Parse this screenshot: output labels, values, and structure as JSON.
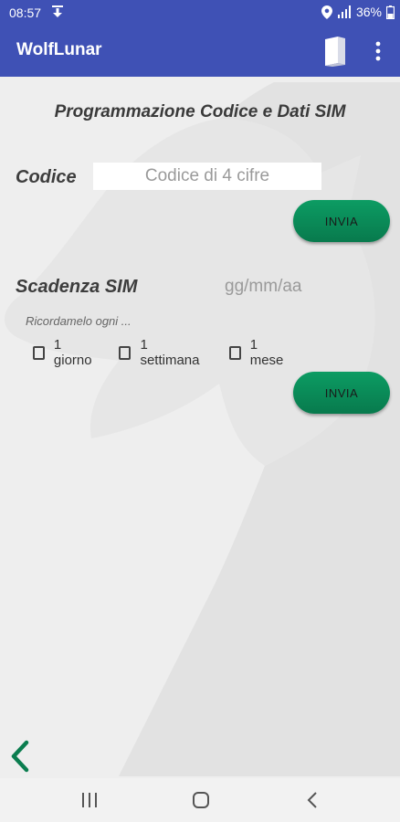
{
  "status_bar": {
    "time": "08:57",
    "battery": "36%",
    "icons": [
      "download-icon",
      "location-icon",
      "signal-icon",
      "battery-icon"
    ]
  },
  "app_bar": {
    "title": "WolfLunar",
    "icons": [
      "book-icon",
      "more-vert-icon"
    ]
  },
  "main": {
    "section_title": "Programmazione Codice e Dati SIM",
    "code": {
      "label": "Codice",
      "placeholder": "Codice di 4 cifre",
      "value": "",
      "button": "INVIA"
    },
    "sim": {
      "label": "Scadenza SIM",
      "date_hint": "gg/mm/aa",
      "reminder_label": "Ricordamelo ogni ...",
      "options": [
        "1 giorno",
        "1 settimana",
        "1 mese"
      ],
      "checked": [
        false,
        false,
        false
      ],
      "button": "INVIA"
    }
  },
  "colors": {
    "primary": "#3f51b5",
    "accent_button": "#0c8f5a",
    "background": "#eeeeee"
  },
  "nav": {
    "icons": [
      "recent-apps-icon",
      "home-icon",
      "back-icon"
    ]
  }
}
